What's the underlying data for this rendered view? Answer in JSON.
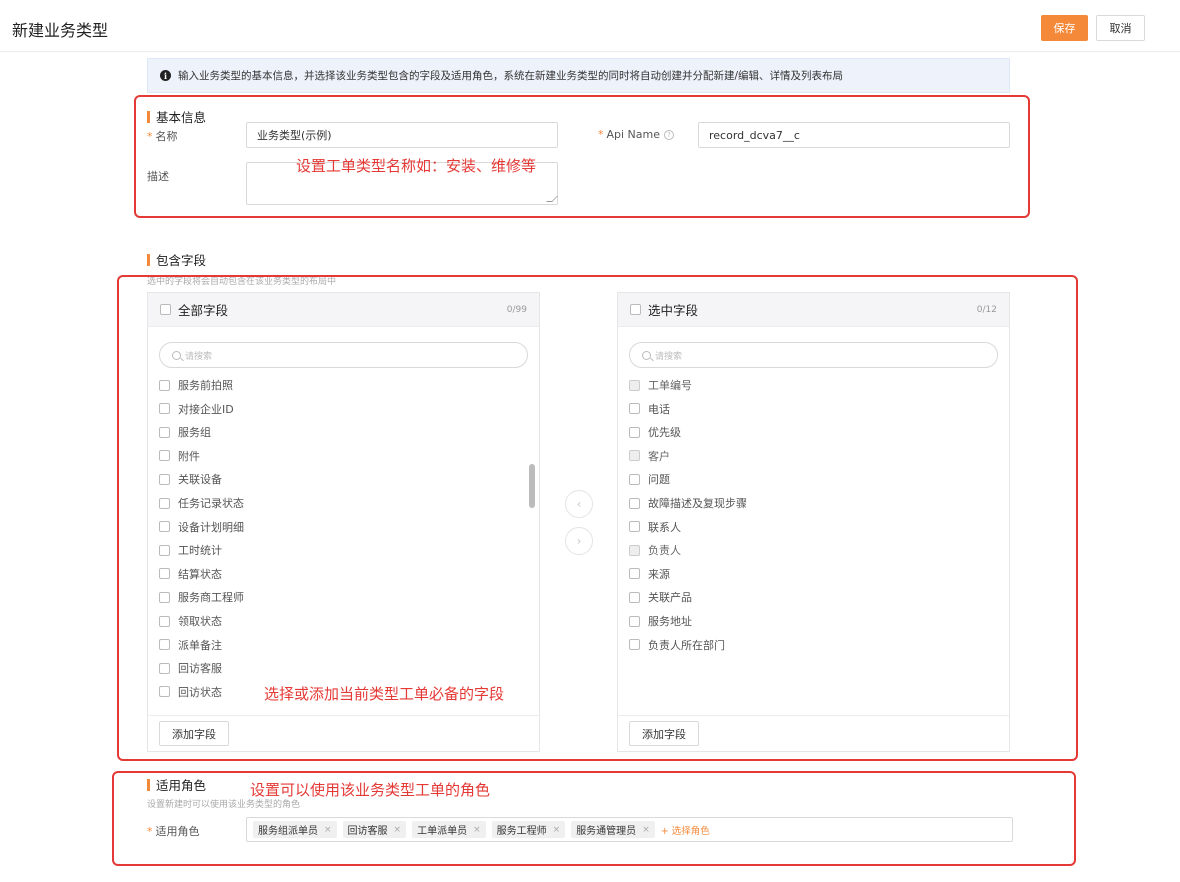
{
  "header": {
    "title": "新建业务类型",
    "save_label": "保存",
    "cancel_label": "取消"
  },
  "notice": {
    "icon": "info-icon",
    "text": "输入业务类型的基本信息，并选择该业务类型包含的字段及适用角色，系统在新建业务类型的同时将自动创建并分配新建/编辑、详情及列表布局"
  },
  "basic_info": {
    "title": "基本信息",
    "name_label": "名称",
    "name_value": "业务类型(示例)",
    "api_label": "Api Name",
    "api_value": "record_dcva7__c",
    "desc_label": "描述",
    "desc_value": "",
    "required_mark": "*"
  },
  "fields": {
    "title": "包含字段",
    "subtitle": "选中的字段将会自动包含在该业务类型的布局中",
    "left": {
      "title": "全部字段",
      "count": "0/99",
      "search_placeholder": "请搜索",
      "items": [
        "服务前拍照",
        "对接企业ID",
        "服务组",
        "附件",
        "关联设备",
        "任务记录状态",
        "设备计划明细",
        "工时统计",
        "结算状态",
        "服务商工程师",
        "领取状态",
        "派单备注",
        "回访客服",
        "回访状态"
      ],
      "add_label": "添加字段"
    },
    "right": {
      "title": "选中字段",
      "count": "0/12",
      "search_placeholder": "请搜索",
      "items": [
        "工单编号",
        "电话",
        "优先级",
        "客户",
        "问题",
        "故障描述及复现步骤",
        "联系人",
        "负责人",
        "来源",
        "关联产品",
        "服务地址",
        "负责人所在部门"
      ],
      "disabled_items": [
        0,
        3,
        7
      ],
      "add_label": "添加字段"
    },
    "move_left": "‹",
    "move_right": "›"
  },
  "roles": {
    "title": "适用角色",
    "subtitle": "设置新建时可以使用该业务类型的角色",
    "label": "适用角色",
    "tags": [
      "服务组派单员",
      "回访客服",
      "工单派单员",
      "服务工程师",
      "服务通管理员"
    ],
    "remove_glyph": "×",
    "add_label": "+ 选择角色"
  },
  "annotations": {
    "name_hint": "设置工单类型名称如：安装、维修等",
    "fields_hint": "选择或添加当前类型工单必备的字段",
    "roles_hint": "设置可以使用该业务类型工单的角色"
  },
  "colors": {
    "accent": "#f5893a",
    "annotation": "#e53935",
    "notice_bg": "#eef3fb"
  }
}
